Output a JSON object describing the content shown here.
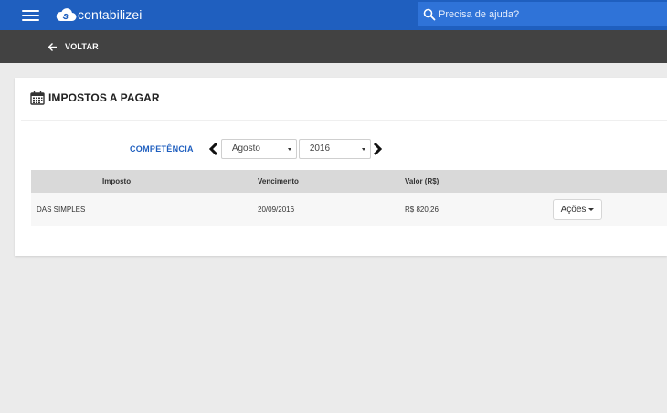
{
  "app": {
    "brand": "contabilizei",
    "brand_color": "#1f5fbf"
  },
  "search": {
    "placeholder": "Precisa de ajuda?"
  },
  "subbar": {
    "back_label": "VOLTAR"
  },
  "card": {
    "title": "IMPOSTOS A PAGAR",
    "competencia_label": "COMPETÊNCIA",
    "month_selected": "Agosto",
    "year_selected": "2016"
  },
  "table": {
    "headers": [
      "Imposto",
      "Vencimento",
      "Valor (R$)"
    ],
    "rows": [
      {
        "imposto": "DAS SIMPLES",
        "vencimento": "20/09/2016",
        "valor": "R$ 820,26",
        "action": "Ações"
      }
    ]
  }
}
